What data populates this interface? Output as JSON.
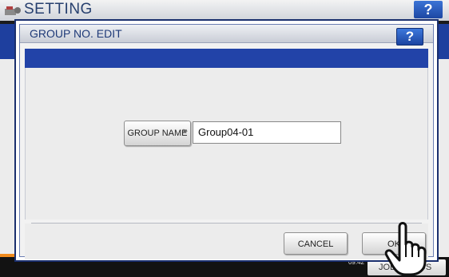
{
  "background": {
    "title": "SETTING",
    "help_label": "?",
    "status_time_line1": "",
    "status_time_line2": "09:42",
    "jobs_label": "JOB STATUS"
  },
  "dialog": {
    "title": "GROUP NO. EDIT",
    "help_label": "?",
    "group_name_button_label": "GROUP NAME",
    "group_name_value": "Group04-01",
    "cancel_label": "CANCEL",
    "ok_label": "OK"
  },
  "icons": {
    "settings_icon": "settings-icon",
    "button_arrow_icon": "triangle-right-icon",
    "pointer_icon": "hand-pointer-icon"
  },
  "colors": {
    "accent_blue": "#2243a8",
    "help_blue": "#3d78dc",
    "title_text": "#1f3a78",
    "status_orange": "#f08a1c"
  }
}
